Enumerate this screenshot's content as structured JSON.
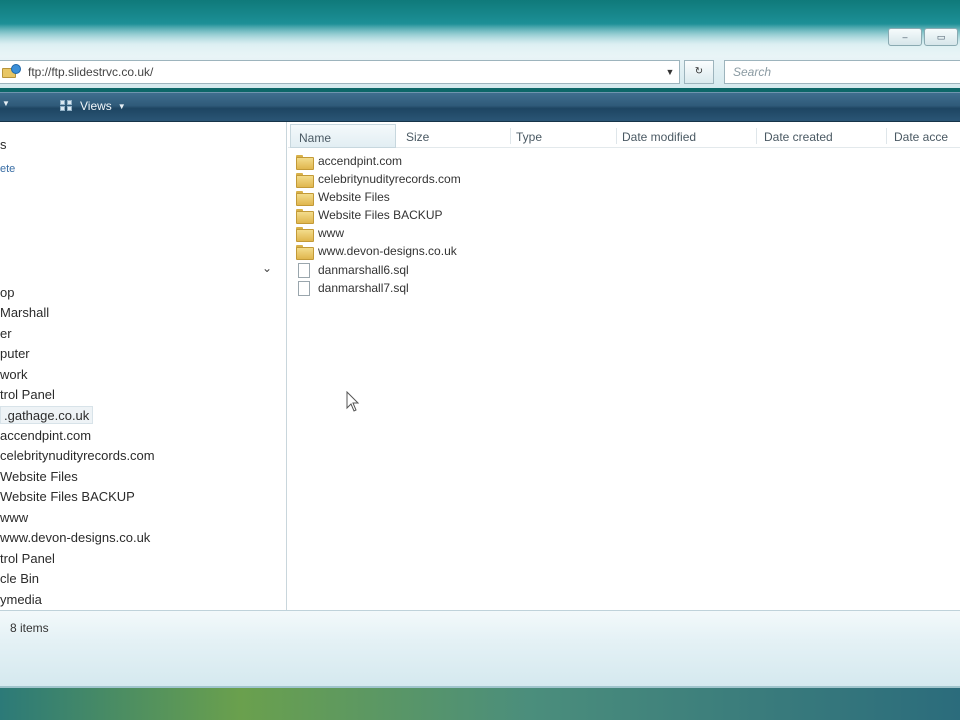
{
  "window": {
    "caption_buttons": [
      "–",
      "▭"
    ]
  },
  "address_bar": {
    "path": "ftp://ftp.slidestrvc.co.uk/",
    "dropdown_icon": "chevron-down-icon",
    "refresh_icon": "refresh-icon",
    "search_placeholder": "Search"
  },
  "command_bar": {
    "views_label": "Views"
  },
  "nav_pane": {
    "items": [
      {
        "label": "s"
      },
      {
        "label": "ete",
        "style": "blue"
      },
      {
        "label": "op"
      },
      {
        "label": "Marshall"
      },
      {
        "label": "er"
      },
      {
        "label": "puter"
      },
      {
        "label": "work"
      },
      {
        "label": "trol Panel"
      },
      {
        "label": ".gathage.co.uk",
        "selected": true
      },
      {
        "label": "accendpint.com"
      },
      {
        "label": "celebritynudityrecords.com"
      },
      {
        "label": "Website Files"
      },
      {
        "label": "Website Files BACKUP"
      },
      {
        "label": "www"
      },
      {
        "label": "www.devon-designs.co.uk"
      },
      {
        "label": "trol Panel"
      },
      {
        "label": "cle Bin"
      },
      {
        "label": "ymedia"
      }
    ]
  },
  "file_list": {
    "columns": [
      "Name",
      "Size",
      "Type",
      "Date modified",
      "Date created",
      "Date acce"
    ],
    "items": [
      {
        "name": "accendpint.com",
        "kind": "folder"
      },
      {
        "name": "celebritynudityrecords.com",
        "kind": "folder"
      },
      {
        "name": "Website Files",
        "kind": "folder"
      },
      {
        "name": "Website Files BACKUP",
        "kind": "folder"
      },
      {
        "name": "www",
        "kind": "folder"
      },
      {
        "name": "www.devon-designs.co.uk",
        "kind": "folder"
      },
      {
        "name": "danmarshall6.sql",
        "kind": "file"
      },
      {
        "name": "danmarshall7.sql",
        "kind": "file"
      }
    ]
  },
  "status_bar": {
    "item_count": "8 items"
  }
}
